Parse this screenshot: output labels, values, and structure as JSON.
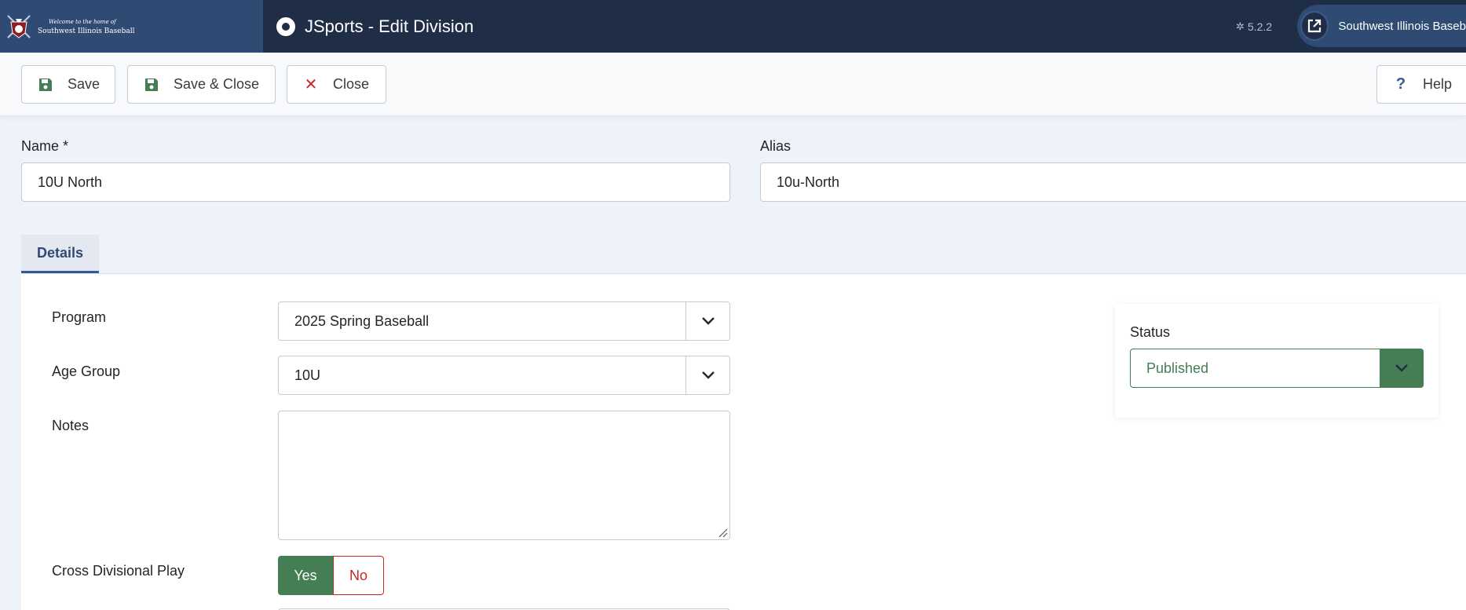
{
  "header": {
    "brand_tagline": "Welcome to the home of",
    "brand_name": "Southwest Illinois Baseball",
    "title": "JSports - Edit Division",
    "version": "5.2.2",
    "site_link_label": "Southwest Illinois Baseball"
  },
  "toolbar": {
    "save_label": "Save",
    "save_close_label": "Save & Close",
    "close_label": "Close",
    "help_label": "Help"
  },
  "form": {
    "name_label": "Name *",
    "name_value": "10U North",
    "alias_label": "Alias",
    "alias_value": "10u-North"
  },
  "tabs": [
    {
      "label": "Details",
      "active": true
    }
  ],
  "details": {
    "program_label": "Program",
    "program_value": "2025 Spring Baseball",
    "age_group_label": "Age Group",
    "age_group_value": "10U",
    "notes_label": "Notes",
    "notes_value": "",
    "cross_div_label": "Cross Divisional Play",
    "cross_div_yes": "Yes",
    "cross_div_no": "No",
    "cross_div_selected": "Yes"
  },
  "status": {
    "label": "Status",
    "value": "Published"
  },
  "colors": {
    "header_bg": "#1f2d47",
    "brand_bg": "#2f4a73",
    "success": "#457d54",
    "danger": "#c52827",
    "link": "#2f5b9a"
  }
}
